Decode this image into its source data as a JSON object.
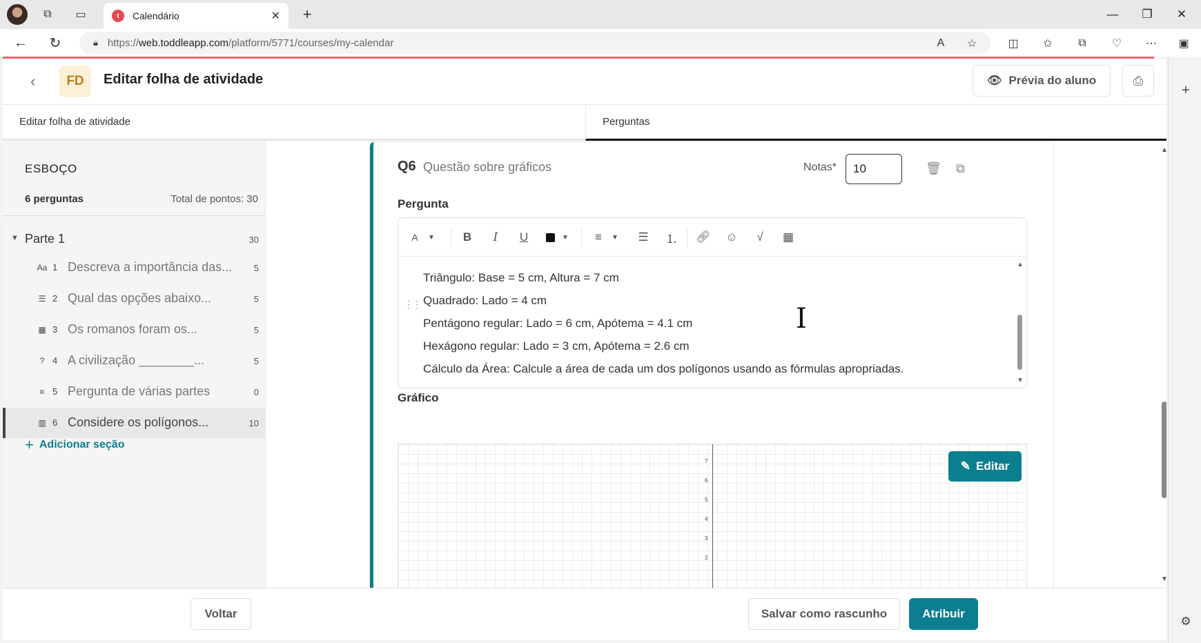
{
  "browser": {
    "tab_title": "Calendário",
    "tab_favicon": "t",
    "url_domain": "web.toddleapp.com",
    "url_prefix": "https://",
    "url_path": "/platform/5771/courses/my-calendar"
  },
  "header": {
    "badge": "FD",
    "title": "Editar folha de atividade",
    "preview_label": "Prévia do aluno"
  },
  "tabs": [
    {
      "label": "Editar folha de atividade"
    },
    {
      "label": "Perguntas"
    }
  ],
  "sidebar": {
    "title": "ESBOÇO",
    "count": "6 perguntas",
    "total": "Total de pontos: 30",
    "part": {
      "label": "Parte 1",
      "points": "30"
    },
    "items": [
      {
        "icon": "Aa",
        "num": "1",
        "text": "Descreva a importância das...",
        "points": "5"
      },
      {
        "icon": "☰",
        "num": "2",
        "text": "Qual das opções abaixo...",
        "points": "5"
      },
      {
        "icon": "▦",
        "num": "3",
        "text": "Os romanos foram os...",
        "points": "5"
      },
      {
        "icon": "?",
        "num": "4",
        "text": "A civilização ________...",
        "points": "5"
      },
      {
        "icon": "≡",
        "num": "5",
        "text": "Pergunta de várias partes",
        "points": "0"
      },
      {
        "icon": "▥",
        "num": "6",
        "text": "Considere os polígonos...",
        "points": "10"
      }
    ],
    "add_section": "Adicionar seção"
  },
  "question": {
    "tag": "Q6",
    "type": "Questão sobre gráficos",
    "notas_label": "Notas*",
    "notas_value": "10",
    "pergunta_label": "Pergunta",
    "lines": [
      "Triângulo: Base = 5 cm, Altura = 7 cm",
      "Quadrado: Lado = 4 cm",
      "Pentágono regular: Lado = 6 cm, Apótema = 4.1 cm",
      "Hexágono regular: Lado = 3 cm, Apótema = 2.6 cm",
      "Cálculo da Área: Calcule a área de cada um dos polígonos usando as fórmulas apropriadas."
    ],
    "grafico_label": "Gráfico",
    "edit_graph_label": "Editar",
    "y_ticks": [
      "7",
      "6",
      "5",
      "4",
      "3",
      "2"
    ]
  },
  "footer": {
    "back": "Voltar",
    "draft": "Salvar como rascunho",
    "assign": "Atribuir"
  },
  "colors": {
    "accent": "#0b7f8f",
    "badge_bg": "#fdf0d8",
    "badge_fg": "#c27a1a",
    "loading_bar": "#f0636b"
  }
}
